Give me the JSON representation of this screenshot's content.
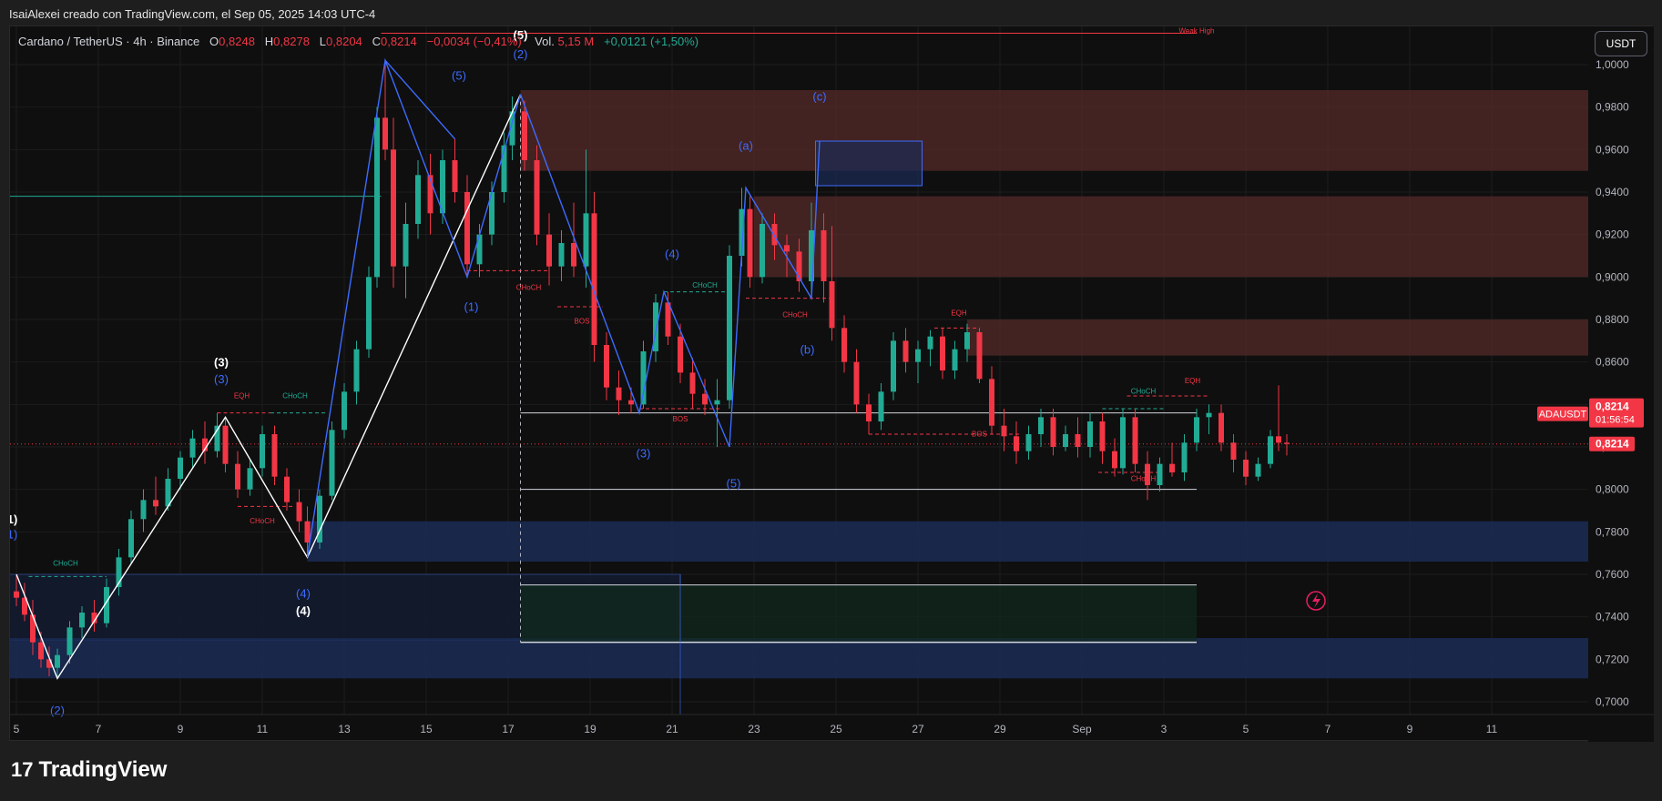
{
  "header": {
    "attribution": "IsaiAlexei creado con TradingView.com, el Sep 05, 2025 14:03 UTC-4"
  },
  "legend": {
    "symbol": "Cardano / TetherUS · 4h · Binance",
    "o_label": "O",
    "o_value": "0,8248",
    "h_label": "H",
    "h_value": "0,8278",
    "l_label": "L",
    "l_value": "0,8204",
    "c_label": "C",
    "c_value": "0,8214",
    "change": "−0,0034 (−0,41%)",
    "vol_label": "Vol.",
    "vol_value": "5,15 M",
    "vol_change": "+0,0121 (+1,50%)"
  },
  "currency_button": "USDT",
  "footer": {
    "brand": "TradingView",
    "brand_mark": "17"
  },
  "colors": {
    "up": "#22ab94",
    "down": "#f23645",
    "wave_blue": "#3d6bff",
    "wave_white": "#ffffff",
    "supply_zone": "#5a2b2b",
    "demand_zone": "#1a2b55",
    "green_zone": "#0f2a1c"
  },
  "chart_data": {
    "type": "candlestick",
    "symbol": "ADAUSDT",
    "timeframe": "4h",
    "x_tick_labels": [
      "5",
      "7",
      "9",
      "11",
      "13",
      "15",
      "17",
      "19",
      "21",
      "23",
      "25",
      "27",
      "29",
      "Sep",
      "3",
      "5",
      "7",
      "9",
      "11"
    ],
    "y_tick_labels": [
      "1,0000",
      "0,9800",
      "0,9600",
      "0,9400",
      "0,9200",
      "0,9000",
      "0,8800",
      "0,8600",
      "0,8400",
      "0,8200",
      "0,8000",
      "0,7800",
      "0,7600",
      "0,7400",
      "0,7200",
      "0,7000"
    ],
    "ylim": [
      0.694,
      1.018
    ],
    "grid": true,
    "last_price_label": "0,8214",
    "symbol_tag": "ADAUSDT",
    "countdown": "01:56:54",
    "candles": [
      {
        "x": 5.0,
        "o": 0.752,
        "h": 0.76,
        "l": 0.745,
        "c": 0.749
      },
      {
        "x": 5.2,
        "o": 0.749,
        "h": 0.756,
        "l": 0.738,
        "c": 0.741
      },
      {
        "x": 5.4,
        "o": 0.741,
        "h": 0.748,
        "l": 0.722,
        "c": 0.728
      },
      {
        "x": 5.6,
        "o": 0.728,
        "h": 0.733,
        "l": 0.716,
        "c": 0.72
      },
      {
        "x": 5.8,
        "o": 0.72,
        "h": 0.726,
        "l": 0.712,
        "c": 0.716
      },
      {
        "x": 6.0,
        "o": 0.716,
        "h": 0.725,
        "l": 0.711,
        "c": 0.722
      },
      {
        "x": 6.3,
        "o": 0.722,
        "h": 0.738,
        "l": 0.718,
        "c": 0.735
      },
      {
        "x": 6.6,
        "o": 0.735,
        "h": 0.745,
        "l": 0.73,
        "c": 0.742
      },
      {
        "x": 6.9,
        "o": 0.742,
        "h": 0.748,
        "l": 0.733,
        "c": 0.737
      },
      {
        "x": 7.2,
        "o": 0.737,
        "h": 0.758,
        "l": 0.735,
        "c": 0.754
      },
      {
        "x": 7.5,
        "o": 0.754,
        "h": 0.772,
        "l": 0.75,
        "c": 0.768
      },
      {
        "x": 7.8,
        "o": 0.768,
        "h": 0.79,
        "l": 0.765,
        "c": 0.786
      },
      {
        "x": 8.1,
        "o": 0.786,
        "h": 0.8,
        "l": 0.78,
        "c": 0.795
      },
      {
        "x": 8.4,
        "o": 0.795,
        "h": 0.806,
        "l": 0.788,
        "c": 0.792
      },
      {
        "x": 8.7,
        "o": 0.792,
        "h": 0.81,
        "l": 0.79,
        "c": 0.805
      },
      {
        "x": 9.0,
        "o": 0.805,
        "h": 0.818,
        "l": 0.8,
        "c": 0.815
      },
      {
        "x": 9.3,
        "o": 0.815,
        "h": 0.828,
        "l": 0.81,
        "c": 0.824
      },
      {
        "x": 9.6,
        "o": 0.824,
        "h": 0.832,
        "l": 0.812,
        "c": 0.818
      },
      {
        "x": 9.9,
        "o": 0.818,
        "h": 0.836,
        "l": 0.815,
        "c": 0.83
      },
      {
        "x": 10.1,
        "o": 0.83,
        "h": 0.834,
        "l": 0.808,
        "c": 0.812
      },
      {
        "x": 10.4,
        "o": 0.812,
        "h": 0.818,
        "l": 0.796,
        "c": 0.8
      },
      {
        "x": 10.7,
        "o": 0.8,
        "h": 0.814,
        "l": 0.797,
        "c": 0.81
      },
      {
        "x": 11.0,
        "o": 0.81,
        "h": 0.83,
        "l": 0.806,
        "c": 0.826
      },
      {
        "x": 11.3,
        "o": 0.826,
        "h": 0.83,
        "l": 0.802,
        "c": 0.806
      },
      {
        "x": 11.6,
        "o": 0.806,
        "h": 0.81,
        "l": 0.79,
        "c": 0.794
      },
      {
        "x": 11.9,
        "o": 0.794,
        "h": 0.8,
        "l": 0.78,
        "c": 0.785
      },
      {
        "x": 12.1,
        "o": 0.785,
        "h": 0.792,
        "l": 0.768,
        "c": 0.775
      },
      {
        "x": 12.4,
        "o": 0.775,
        "h": 0.8,
        "l": 0.772,
        "c": 0.797
      },
      {
        "x": 12.7,
        "o": 0.797,
        "h": 0.832,
        "l": 0.795,
        "c": 0.828
      },
      {
        "x": 13.0,
        "o": 0.828,
        "h": 0.85,
        "l": 0.824,
        "c": 0.846
      },
      {
        "x": 13.3,
        "o": 0.846,
        "h": 0.87,
        "l": 0.84,
        "c": 0.866
      },
      {
        "x": 13.6,
        "o": 0.866,
        "h": 0.905,
        "l": 0.862,
        "c": 0.9
      },
      {
        "x": 13.8,
        "o": 0.9,
        "h": 0.98,
        "l": 0.895,
        "c": 0.975
      },
      {
        "x": 14.0,
        "o": 0.975,
        "h": 1.002,
        "l": 0.955,
        "c": 0.96
      },
      {
        "x": 14.2,
        "o": 0.96,
        "h": 0.975,
        "l": 0.895,
        "c": 0.905
      },
      {
        "x": 14.5,
        "o": 0.905,
        "h": 0.935,
        "l": 0.89,
        "c": 0.925
      },
      {
        "x": 14.8,
        "o": 0.925,
        "h": 0.955,
        "l": 0.918,
        "c": 0.948
      },
      {
        "x": 15.1,
        "o": 0.948,
        "h": 0.958,
        "l": 0.92,
        "c": 0.93
      },
      {
        "x": 15.4,
        "o": 0.93,
        "h": 0.96,
        "l": 0.925,
        "c": 0.955
      },
      {
        "x": 15.7,
        "o": 0.955,
        "h": 0.965,
        "l": 0.935,
        "c": 0.94
      },
      {
        "x": 16.0,
        "o": 0.94,
        "h": 0.948,
        "l": 0.9,
        "c": 0.906
      },
      {
        "x": 16.3,
        "o": 0.906,
        "h": 0.925,
        "l": 0.9,
        "c": 0.92
      },
      {
        "x": 16.6,
        "o": 0.92,
        "h": 0.945,
        "l": 0.915,
        "c": 0.94
      },
      {
        "x": 16.9,
        "o": 0.94,
        "h": 0.968,
        "l": 0.935,
        "c": 0.962
      },
      {
        "x": 17.1,
        "o": 0.962,
        "h": 0.985,
        "l": 0.955,
        "c": 0.978
      },
      {
        "x": 17.4,
        "o": 0.978,
        "h": 0.983,
        "l": 0.95,
        "c": 0.955
      },
      {
        "x": 17.7,
        "o": 0.955,
        "h": 0.962,
        "l": 0.915,
        "c": 0.92
      },
      {
        "x": 18.0,
        "o": 0.92,
        "h": 0.93,
        "l": 0.896,
        "c": 0.905
      },
      {
        "x": 18.3,
        "o": 0.905,
        "h": 0.922,
        "l": 0.898,
        "c": 0.916
      },
      {
        "x": 18.6,
        "o": 0.916,
        "h": 0.935,
        "l": 0.9,
        "c": 0.905
      },
      {
        "x": 18.9,
        "o": 0.905,
        "h": 0.96,
        "l": 0.895,
        "c": 0.93
      },
      {
        "x": 19.1,
        "o": 0.93,
        "h": 0.94,
        "l": 0.86,
        "c": 0.868
      },
      {
        "x": 19.4,
        "o": 0.868,
        "h": 0.874,
        "l": 0.842,
        "c": 0.848
      },
      {
        "x": 19.7,
        "o": 0.848,
        "h": 0.856,
        "l": 0.835,
        "c": 0.842
      },
      {
        "x": 20.0,
        "o": 0.842,
        "h": 0.848,
        "l": 0.836,
        "c": 0.84
      },
      {
        "x": 20.3,
        "o": 0.84,
        "h": 0.87,
        "l": 0.838,
        "c": 0.865
      },
      {
        "x": 20.6,
        "o": 0.865,
        "h": 0.892,
        "l": 0.86,
        "c": 0.888
      },
      {
        "x": 20.9,
        "o": 0.888,
        "h": 0.893,
        "l": 0.868,
        "c": 0.872
      },
      {
        "x": 21.2,
        "o": 0.872,
        "h": 0.878,
        "l": 0.85,
        "c": 0.855
      },
      {
        "x": 21.5,
        "o": 0.855,
        "h": 0.862,
        "l": 0.838,
        "c": 0.845
      },
      {
        "x": 21.8,
        "o": 0.845,
        "h": 0.852,
        "l": 0.835,
        "c": 0.84
      },
      {
        "x": 22.1,
        "o": 0.84,
        "h": 0.852,
        "l": 0.82,
        "c": 0.842
      },
      {
        "x": 22.4,
        "o": 0.842,
        "h": 0.915,
        "l": 0.838,
        "c": 0.91
      },
      {
        "x": 22.7,
        "o": 0.91,
        "h": 0.942,
        "l": 0.905,
        "c": 0.932
      },
      {
        "x": 22.9,
        "o": 0.932,
        "h": 0.938,
        "l": 0.895,
        "c": 0.9
      },
      {
        "x": 23.2,
        "o": 0.9,
        "h": 0.93,
        "l": 0.897,
        "c": 0.925
      },
      {
        "x": 23.5,
        "o": 0.925,
        "h": 0.93,
        "l": 0.908,
        "c": 0.915
      },
      {
        "x": 23.8,
        "o": 0.915,
        "h": 0.92,
        "l": 0.9,
        "c": 0.912
      },
      {
        "x": 24.1,
        "o": 0.912,
        "h": 0.918,
        "l": 0.893,
        "c": 0.898
      },
      {
        "x": 24.4,
        "o": 0.898,
        "h": 0.935,
        "l": 0.892,
        "c": 0.922
      },
      {
        "x": 24.7,
        "o": 0.922,
        "h": 0.93,
        "l": 0.888,
        "c": 0.898
      },
      {
        "x": 24.9,
        "o": 0.898,
        "h": 0.924,
        "l": 0.87,
        "c": 0.876
      },
      {
        "x": 25.2,
        "o": 0.876,
        "h": 0.882,
        "l": 0.855,
        "c": 0.86
      },
      {
        "x": 25.5,
        "o": 0.86,
        "h": 0.866,
        "l": 0.836,
        "c": 0.84
      },
      {
        "x": 25.8,
        "o": 0.84,
        "h": 0.845,
        "l": 0.826,
        "c": 0.832
      },
      {
        "x": 26.1,
        "o": 0.832,
        "h": 0.85,
        "l": 0.828,
        "c": 0.846
      },
      {
        "x": 26.4,
        "o": 0.846,
        "h": 0.874,
        "l": 0.842,
        "c": 0.87
      },
      {
        "x": 26.7,
        "o": 0.87,
        "h": 0.876,
        "l": 0.855,
        "c": 0.86
      },
      {
        "x": 27.0,
        "o": 0.86,
        "h": 0.87,
        "l": 0.85,
        "c": 0.866
      },
      {
        "x": 27.3,
        "o": 0.866,
        "h": 0.875,
        "l": 0.858,
        "c": 0.872
      },
      {
        "x": 27.6,
        "o": 0.872,
        "h": 0.876,
        "l": 0.852,
        "c": 0.856
      },
      {
        "x": 27.9,
        "o": 0.856,
        "h": 0.87,
        "l": 0.852,
        "c": 0.866
      },
      {
        "x": 28.2,
        "o": 0.866,
        "h": 0.878,
        "l": 0.86,
        "c": 0.874
      },
      {
        "x": 28.5,
        "o": 0.874,
        "h": 0.876,
        "l": 0.85,
        "c": 0.852
      },
      {
        "x": 28.8,
        "o": 0.852,
        "h": 0.858,
        "l": 0.826,
        "c": 0.83
      },
      {
        "x": 29.1,
        "o": 0.83,
        "h": 0.838,
        "l": 0.818,
        "c": 0.825
      },
      {
        "x": 29.4,
        "o": 0.825,
        "h": 0.832,
        "l": 0.812,
        "c": 0.818
      },
      {
        "x": 29.7,
        "o": 0.818,
        "h": 0.83,
        "l": 0.814,
        "c": 0.826
      },
      {
        "x": 30.0,
        "o": 0.826,
        "h": 0.838,
        "l": 0.82,
        "c": 0.834
      },
      {
        "x": 30.3,
        "o": 0.834,
        "h": 0.838,
        "l": 0.816,
        "c": 0.82
      },
      {
        "x": 30.6,
        "o": 0.82,
        "h": 0.83,
        "l": 0.818,
        "c": 0.826
      },
      {
        "x": 30.9,
        "o": 0.826,
        "h": 0.834,
        "l": 0.815,
        "c": 0.82
      },
      {
        "x": 31.2,
        "o": 0.82,
        "h": 0.836,
        "l": 0.815,
        "c": 0.832
      },
      {
        "x": 31.5,
        "o": 0.832,
        "h": 0.836,
        "l": 0.812,
        "c": 0.818
      },
      {
        "x": 31.8,
        "o": 0.818,
        "h": 0.824,
        "l": 0.806,
        "c": 0.81
      },
      {
        "x": 32.0,
        "o": 0.81,
        "h": 0.838,
        "l": 0.807,
        "c": 0.834
      },
      {
        "x": 32.3,
        "o": 0.834,
        "h": 0.838,
        "l": 0.808,
        "c": 0.812
      },
      {
        "x": 32.6,
        "o": 0.812,
        "h": 0.818,
        "l": 0.795,
        "c": 0.802
      },
      {
        "x": 32.9,
        "o": 0.802,
        "h": 0.815,
        "l": 0.799,
        "c": 0.812
      },
      {
        "x": 33.2,
        "o": 0.812,
        "h": 0.822,
        "l": 0.806,
        "c": 0.808
      },
      {
        "x": 33.5,
        "o": 0.808,
        "h": 0.826,
        "l": 0.804,
        "c": 0.822
      },
      {
        "x": 33.8,
        "o": 0.822,
        "h": 0.838,
        "l": 0.818,
        "c": 0.834
      },
      {
        "x": 34.1,
        "o": 0.834,
        "h": 0.84,
        "l": 0.826,
        "c": 0.836
      },
      {
        "x": 34.4,
        "o": 0.836,
        "h": 0.84,
        "l": 0.818,
        "c": 0.822
      },
      {
        "x": 34.7,
        "o": 0.822,
        "h": 0.826,
        "l": 0.808,
        "c": 0.814
      },
      {
        "x": 35.0,
        "o": 0.814,
        "h": 0.818,
        "l": 0.802,
        "c": 0.806
      },
      {
        "x": 35.3,
        "o": 0.806,
        "h": 0.815,
        "l": 0.804,
        "c": 0.812
      },
      {
        "x": 35.6,
        "o": 0.812,
        "h": 0.828,
        "l": 0.81,
        "c": 0.825
      },
      {
        "x": 35.8,
        "o": 0.825,
        "h": 0.849,
        "l": 0.818,
        "c": 0.822
      },
      {
        "x": 36.0,
        "o": 0.822,
        "h": 0.826,
        "l": 0.816,
        "c": 0.8214
      }
    ],
    "waves": [
      {
        "color": "white",
        "points": [
          [
            5.0,
            0.76
          ],
          [
            6.0,
            0.711
          ],
          [
            10.1,
            0.834
          ],
          [
            12.1,
            0.768
          ],
          [
            17.3,
            0.986
          ]
        ]
      },
      {
        "color": "blue",
        "points": [
          [
            12.1,
            0.768
          ],
          [
            14.0,
            1.002
          ],
          [
            16.0,
            0.9
          ],
          [
            17.3,
            0.986
          ]
        ]
      },
      {
        "color": "blue",
        "points": [
          [
            14.0,
            1.002
          ],
          [
            15.7,
            0.965
          ]
        ]
      },
      {
        "color": "blue",
        "points": [
          [
            17.3,
            0.986
          ],
          [
            20.2,
            0.836
          ],
          [
            20.8,
            0.893
          ],
          [
            22.4,
            0.82
          ]
        ]
      },
      {
        "color": "blue",
        "points": [
          [
            22.4,
            0.82
          ],
          [
            22.8,
            0.942
          ],
          [
            24.4,
            0.89
          ],
          [
            24.6,
            0.964
          ]
        ]
      }
    ],
    "labels": [
      {
        "text": "(5)",
        "x": 17.3,
        "y": 1.012,
        "color": "white"
      },
      {
        "text": "(2)",
        "x": 17.3,
        "y": 1.003,
        "color": "blue"
      },
      {
        "text": "(5)",
        "x": 15.8,
        "y": 0.993,
        "color": "blue"
      },
      {
        "text": "(1)",
        "x": 16.1,
        "y": 0.884,
        "color": "blue"
      },
      {
        "text": "(3)",
        "x": 10.0,
        "y": 0.858,
        "color": "white"
      },
      {
        "text": "(3)",
        "x": 10.0,
        "y": 0.85,
        "color": "blue"
      },
      {
        "text": "(4)",
        "x": 12.0,
        "y": 0.749,
        "color": "blue"
      },
      {
        "text": "(4)",
        "x": 12.0,
        "y": 0.741,
        "color": "white"
      },
      {
        "text": "1)",
        "x": 4.9,
        "y": 0.784,
        "color": "white"
      },
      {
        "text": "1)",
        "x": 4.9,
        "y": 0.777,
        "color": "blue"
      },
      {
        "text": "(2)",
        "x": 6.0,
        "y": 0.694,
        "color": "blue"
      },
      {
        "text": "(4)",
        "x": 21.0,
        "y": 0.909,
        "color": "blue"
      },
      {
        "text": "(3)",
        "x": 20.3,
        "y": 0.815,
        "color": "blue"
      },
      {
        "text": "(5)",
        "x": 22.5,
        "y": 0.801,
        "color": "blue"
      },
      {
        "text": "(a)",
        "x": 22.8,
        "y": 0.96,
        "color": "blue"
      },
      {
        "text": "(b)",
        "x": 24.3,
        "y": 0.864,
        "color": "blue"
      },
      {
        "text": "(c)",
        "x": 24.6,
        "y": 0.983,
        "color": "blue"
      }
    ],
    "small_labels": [
      {
        "text": "Weak High",
        "x": 33.8,
        "y": 1.0148,
        "color": "red"
      },
      {
        "text": "CHoCH",
        "x": 17.5,
        "y": 0.894,
        "color": "red"
      },
      {
        "text": "BOS",
        "x": 18.8,
        "y": 0.878,
        "color": "red"
      },
      {
        "text": "BOS",
        "x": 21.2,
        "y": 0.832,
        "color": "red"
      },
      {
        "text": "CHoCH",
        "x": 21.8,
        "y": 0.895,
        "color": "green"
      },
      {
        "text": "CHoCH",
        "x": 24.0,
        "y": 0.881,
        "color": "red"
      },
      {
        "text": "EQH",
        "x": 10.5,
        "y": 0.843,
        "color": "red"
      },
      {
        "text": "CHoCH",
        "x": 11.8,
        "y": 0.843,
        "color": "green"
      },
      {
        "text": "CHoCH",
        "x": 11.0,
        "y": 0.784,
        "color": "red"
      },
      {
        "text": "CHoCH",
        "x": 6.2,
        "y": 0.764,
        "color": "green"
      },
      {
        "text": "EQH",
        "x": 28.0,
        "y": 0.882,
        "color": "red"
      },
      {
        "text": "BOS",
        "x": 28.5,
        "y": 0.825,
        "color": "red"
      },
      {
        "text": "CHoCH",
        "x": 32.5,
        "y": 0.845,
        "color": "green"
      },
      {
        "text": "EQH",
        "x": 33.7,
        "y": 0.85,
        "color": "red"
      },
      {
        "text": "CHoCH",
        "x": 32.5,
        "y": 0.804,
        "color": "red"
      }
    ]
  }
}
